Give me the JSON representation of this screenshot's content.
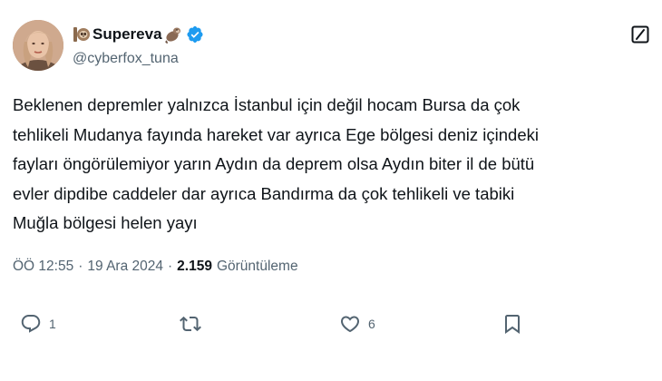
{
  "author": {
    "display_name": "Supereva",
    "handle": "@cyberfox_tuna",
    "verified": true,
    "name_emojis": [
      "sloth-emoji",
      "otter-emoji"
    ]
  },
  "tweet": {
    "text": "Beklenen depremler yalnızca İstanbul için değil hocam Bursa da çok\ntehlikeli Mudanya fayında hareket var ayrıca Ege bölgesi deniz içindeki\nfayları öngörülemiyor yarın Aydın da deprem olsa Aydın biter il de bütü\nevler dipdibe caddeler dar ayrıca Bandırma da çok tehlikeli ve tabiki\nMuğla bölgesi helen yayı"
  },
  "meta": {
    "time": "ÖÖ 12:55",
    "separator": "·",
    "date": "19 Ara 2024",
    "views_count": "2.159",
    "views_label": "Görüntüleme"
  },
  "actions": {
    "reply_count": "1",
    "retweet_count": "",
    "like_count": "6"
  },
  "colors": {
    "text_primary": "#0f1419",
    "text_secondary": "#536471",
    "verified_blue": "#1d9bf0"
  }
}
